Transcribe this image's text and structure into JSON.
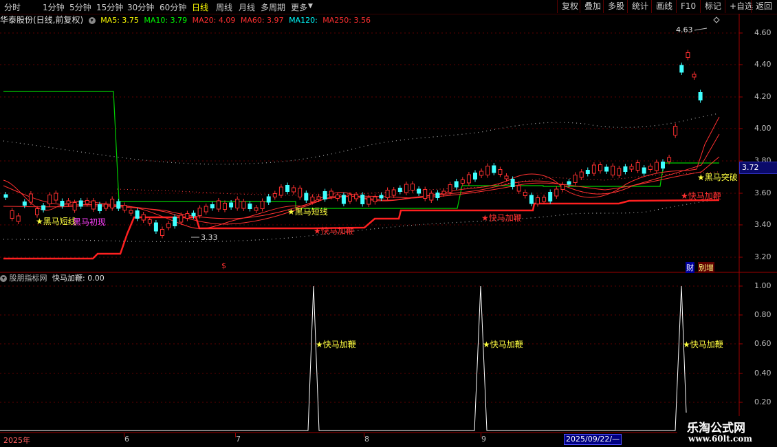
{
  "toolbar": {
    "periods": [
      "分时",
      "1分钟",
      "5分钟",
      "15分钟",
      "30分钟",
      "60分钟",
      "日线",
      "周线",
      "月线",
      "多周期",
      "更多"
    ],
    "active_period": "日线",
    "right_buttons": [
      "复权",
      "叠加",
      "多股",
      "统计",
      "画线",
      "F10",
      "标记",
      "+自选",
      "返回"
    ]
  },
  "info": {
    "stock": "华泰股份(日线,前复权)",
    "ma5": "MA5: 3.75",
    "ma10": "MA10: 3.79",
    "ma20": "MA20: 4.09",
    "ma60": "MA60: 3.97",
    "ma120": "MA120:",
    "ma250": "MA250: 3.56",
    "colors": {
      "ma5": "#ffff00",
      "ma10": "#00ff00",
      "ma20": "#ff3030",
      "ma60": "#ff3030",
      "ma120": "#00ffff",
      "ma250": "#ff3030"
    }
  },
  "indicator": {
    "title": "股朋指标网",
    "value": "快马加鞭: 0.00",
    "signal_label": "★快马加鞭",
    "y_ticks": [
      "1.00",
      "0.80",
      "0.60",
      "0.40",
      "0.20"
    ]
  },
  "price_axis": {
    "ticks": [
      "4.60",
      "4.40",
      "4.20",
      "4.00",
      "3.80",
      "3.60",
      "3.40",
      "3.20"
    ],
    "current_price": "3.72"
  },
  "annotations": {
    "high": "4.63",
    "low": "3.33",
    "dollar": "$",
    "heima_duanxian": "黑马短线",
    "heima_chuxian": "黑马初现",
    "kuaima": "快马加鞭",
    "heima_tupo": "黑马突破",
    "cai": "财",
    "bie": "别增"
  },
  "x_axis": {
    "labels": [
      "2025年",
      "6",
      "7",
      "8",
      "9"
    ],
    "date_box": "2025/09/22/—"
  },
  "brand": {
    "name": "乐淘公式网",
    "url": "www.60lt.com"
  }
}
